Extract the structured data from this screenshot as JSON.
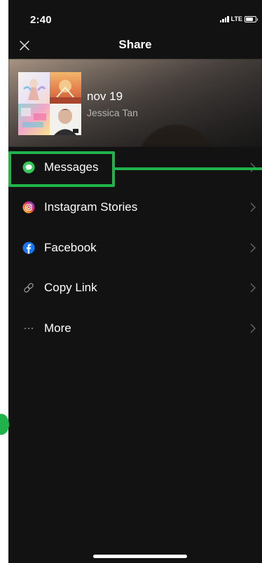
{
  "status_bar": {
    "time": "2:40",
    "network": "LTE"
  },
  "header": {
    "title": "Share",
    "close_icon": "close-icon"
  },
  "hero": {
    "title": "nov 19",
    "subtitle": "Jessica Tan"
  },
  "share_options": [
    {
      "label": "Messages",
      "icon": "messages-icon"
    },
    {
      "label": "Instagram Stories",
      "icon": "instagram-icon"
    },
    {
      "label": "Facebook",
      "icon": "facebook-icon"
    },
    {
      "label": "Copy Link",
      "icon": "link-icon"
    },
    {
      "label": "More",
      "icon": "more-icon"
    }
  ],
  "colors": {
    "background": "#121212",
    "text": "#ffffff",
    "secondary_text": "#b3b3b3",
    "highlight": "#22b24c",
    "messages": "#34c759",
    "facebook": "#1877f2"
  }
}
